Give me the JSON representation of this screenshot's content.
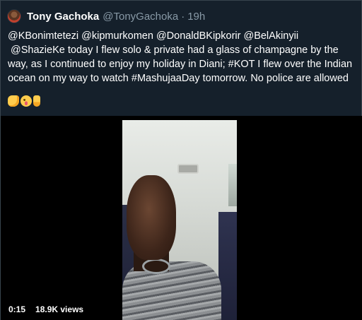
{
  "author": {
    "name": "Tony Gachoka",
    "handle": "@TonyGachoka",
    "separator": "·",
    "time": "19h"
  },
  "tweet": {
    "text": "@KBonimtetezi @kipmurkomen @DonaldBKipkorir @BelAkinyii\n @ShazieKe today I flew solo & private had a glass of champagne by the way, as I continued to enjoy my holiday in Diani; #KOT I flew over the Indian ocean on my way to watch #MashujaaDay tomorrow. No police are allowed",
    "emojis": [
      "fist-icon",
      "winking-face-tongue-icon",
      "pointing-down-icon"
    ]
  },
  "video": {
    "duration": "0:15",
    "views": "18.9K views"
  },
  "colors": {
    "background": "#15202b",
    "secondary_text": "#8899a6",
    "border": "#38444d"
  }
}
